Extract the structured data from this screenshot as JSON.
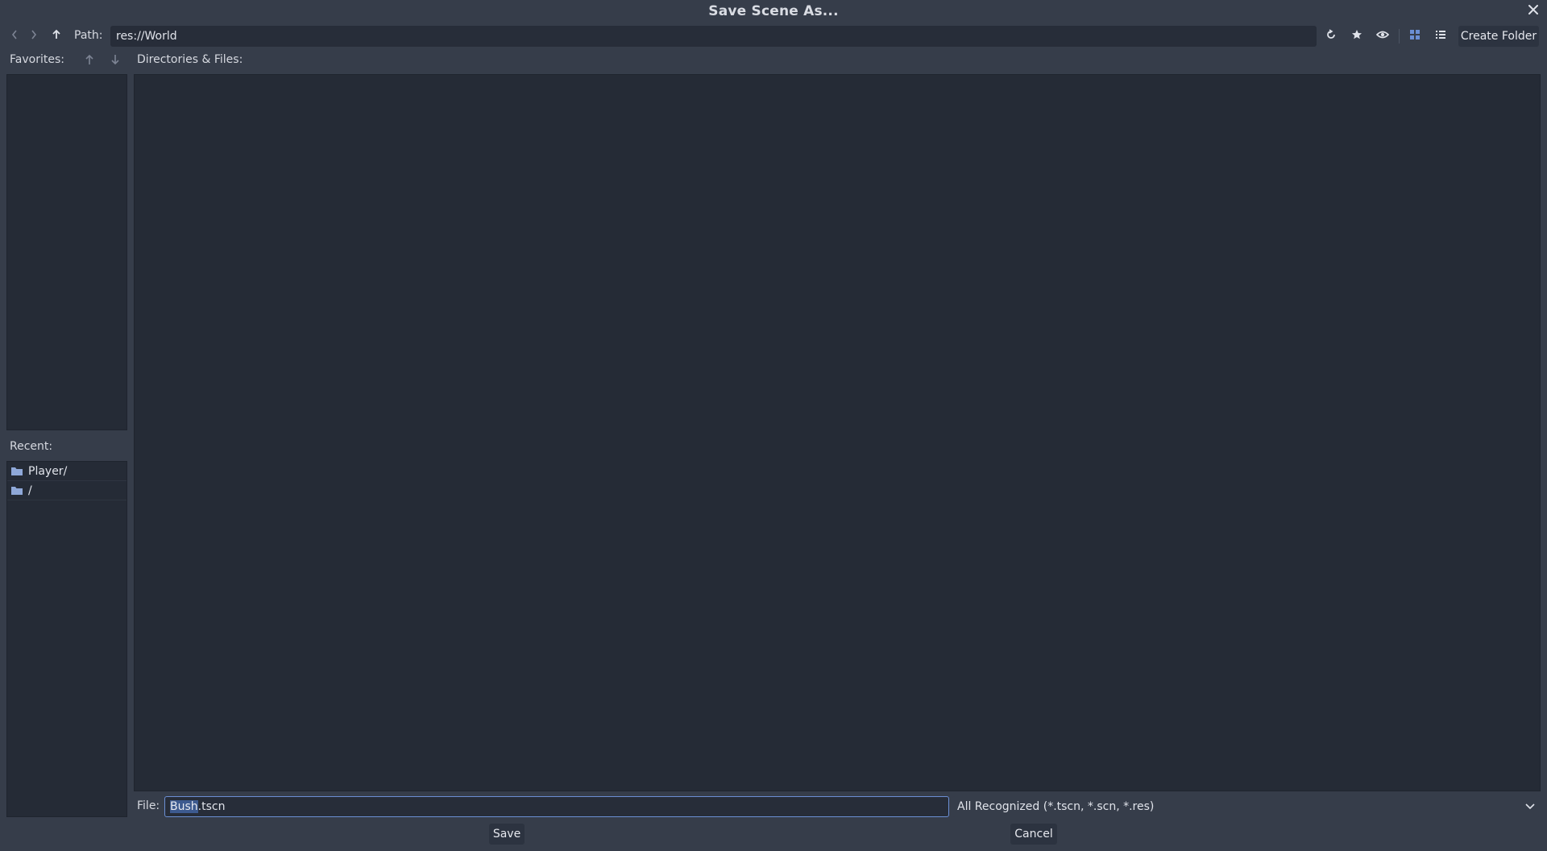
{
  "window": {
    "title": "Save Scene As..."
  },
  "toolbar": {
    "path_label": "Path:",
    "path_value": "res://World",
    "create_folder_label": "Create Folder"
  },
  "favorites": {
    "label": "Favorites:",
    "items": []
  },
  "recent": {
    "label": "Recent:",
    "items": [
      {
        "label": "Player/"
      },
      {
        "label": "/"
      }
    ]
  },
  "files": {
    "label": "Directories & Files:",
    "items": []
  },
  "file_row": {
    "label": "File:",
    "selected_part": "Bush",
    "rest_part": ".tscn",
    "filter_value": "All Recognized (*.tscn, *.scn, *.res)"
  },
  "buttons": {
    "save": "Save",
    "cancel": "Cancel"
  },
  "icons": {
    "close": "close-icon",
    "back": "chevron-left-icon",
    "forward": "chevron-right-icon",
    "up": "arrow-up-icon",
    "refresh": "refresh-icon",
    "favorite": "star-icon",
    "hidden": "eye-icon",
    "grid": "grid-view-icon",
    "list": "list-view-icon",
    "folder": "folder-icon"
  },
  "colors": {
    "accent": "#6b8fd4",
    "selection": "#3d5a8f",
    "folder": "#8fa8d8"
  }
}
